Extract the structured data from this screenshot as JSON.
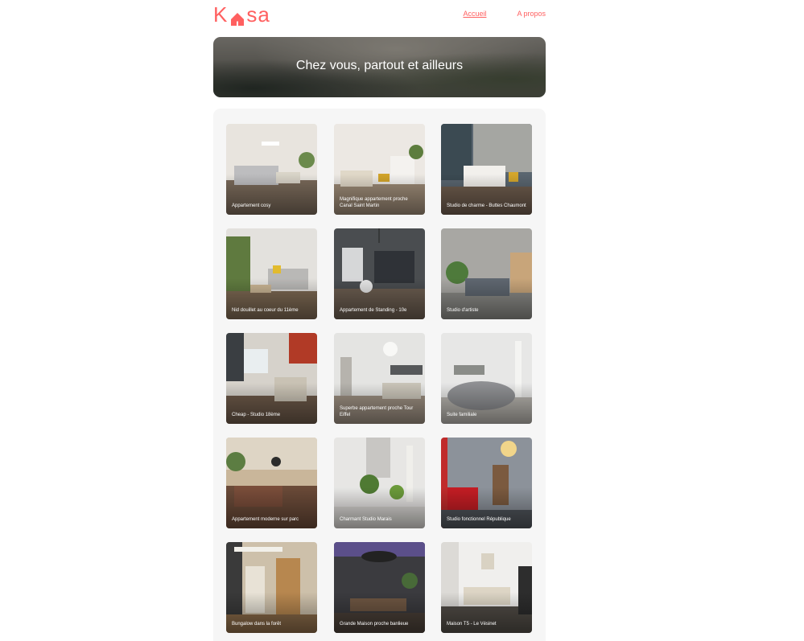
{
  "brand": {
    "name": "Kasa",
    "letters_left": "K",
    "letters_right": "sa",
    "color": "#ff6060"
  },
  "nav": {
    "home": "Accueil",
    "about": "A propos"
  },
  "banner": {
    "title": "Chez vous, partout et ailleurs"
  },
  "listings": [
    {
      "title": "Appartement cosy"
    },
    {
      "title": "Magnifique appartement proche Canal Saint Martin"
    },
    {
      "title": "Studio de charme - Buttes Chaumont"
    },
    {
      "title": "Nid douillet au coeur du 11ème"
    },
    {
      "title": "Appartement de Standing - 10e"
    },
    {
      "title": "Studio d'artiste"
    },
    {
      "title": "Cheap - Studio 18ème"
    },
    {
      "title": "Superbe appartement proche Tour Eiffel"
    },
    {
      "title": "Suite familiale"
    },
    {
      "title": "Appartement moderne sur parc"
    },
    {
      "title": "Charmant Studio Marais"
    },
    {
      "title": "Studio fonctionnel République"
    },
    {
      "title": "Bungalow dans la forêt"
    },
    {
      "title": "Grande Maison proche banlieue"
    },
    {
      "title": "Maison T5 - Le Vésinet"
    }
  ]
}
